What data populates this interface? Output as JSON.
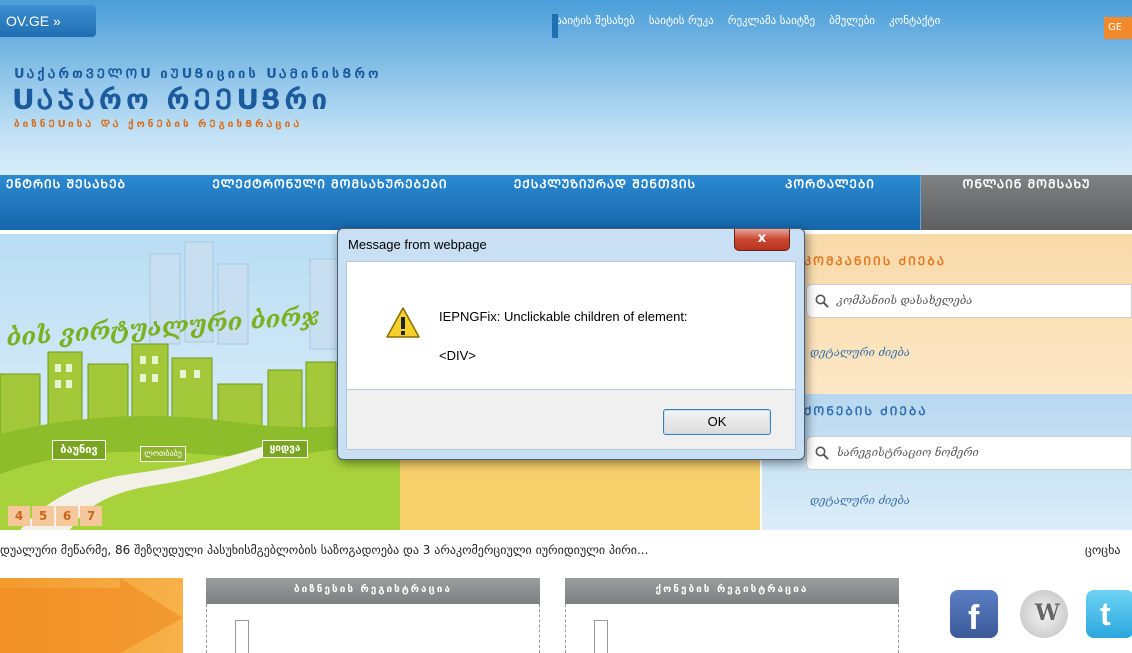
{
  "header": {
    "gov_link": "OV.GE »",
    "top_links": [
      "საიტის შესახებ",
      "საიტის რუკა",
      "რეკლამა საიტზე",
      "ბმულები",
      "კონტაქტი"
    ],
    "lang_button": "GE",
    "logo_line1": "ՍᲐქᲐრთᲕᲔᲚᲝՍ იᲣՍՑიციის ՍᲐᲛინისՑრო",
    "logo_line2": "ՍᲐᲯᲐრო რᲔᲔՍՑრი",
    "logo_line3": "ბიზნᲔՍისᲐ ᲓᲐ ქონᲔბის რᲔგისՑრᲐციᲐ"
  },
  "nav": {
    "items": [
      {
        "label": "ᲔნᲢᲠᲘᲡ ᲨᲔᲡᲐᲮᲔᲑ"
      },
      {
        "label": "ᲔᲚᲔᲥᲢᲠᲝᲜᲣᲚᲘ ᲛᲝᲛᲡᲐᲮᲣᲠᲔᲑᲔᲑᲘ"
      },
      {
        "label": "ᲔᲥᲡᲙᲚᲣᲖᲘᲣᲠᲐᲓ ᲨᲔᲜᲗᲕᲘᲡ"
      },
      {
        "label": "ᲞᲝᲠᲢᲐᲚᲔᲑᲘ"
      },
      {
        "label": "ᲝᲜᲚᲐᲘᲜ ᲛᲝᲛᲡᲐᲮᲣ"
      }
    ]
  },
  "banner": {
    "title": "ბის ვირტუალური ბირჯ",
    "signs": [
      "ბაუნივ",
      "ლოთბაბე",
      "ყიდვა"
    ],
    "pages": [
      "4",
      "5",
      "6",
      "7"
    ]
  },
  "panel_company": {
    "title": "ᲙᲝᲛᲞᲐᲜᲘᲘᲡ ᲫᲘᲔᲑᲐ",
    "placeholder": "კომპანიის დასახელება",
    "link": "დეტალური ძიება"
  },
  "panel_property": {
    "title": "ᲥᲝᲜᲔᲑᲘᲡ ᲫᲘᲔᲑᲐ",
    "placeholder": "სარეგისტრაციო ნომერი",
    "link": "დეტალური ძიება"
  },
  "ticker": {
    "text": "დუალური მეწარმე, 86 შეზღუდული პასუხისმგებლობის საზოგადოება და 3 არაკომერციული იურიდიული პირი...",
    "right": "ცოცხა"
  },
  "bottom": {
    "tab_business": "ბიზნესის რეგისტრაცია",
    "tab_property": "ქონების რეგისტრაცია"
  },
  "social": [
    "facebook-icon",
    "wikipedia-icon",
    "twitter-icon"
  ],
  "dialog": {
    "title": "Message from webpage",
    "message": "IEPNGFix: Unclickable children of element:",
    "detail": "<DIV>",
    "ok": "OK",
    "close": "x"
  }
}
